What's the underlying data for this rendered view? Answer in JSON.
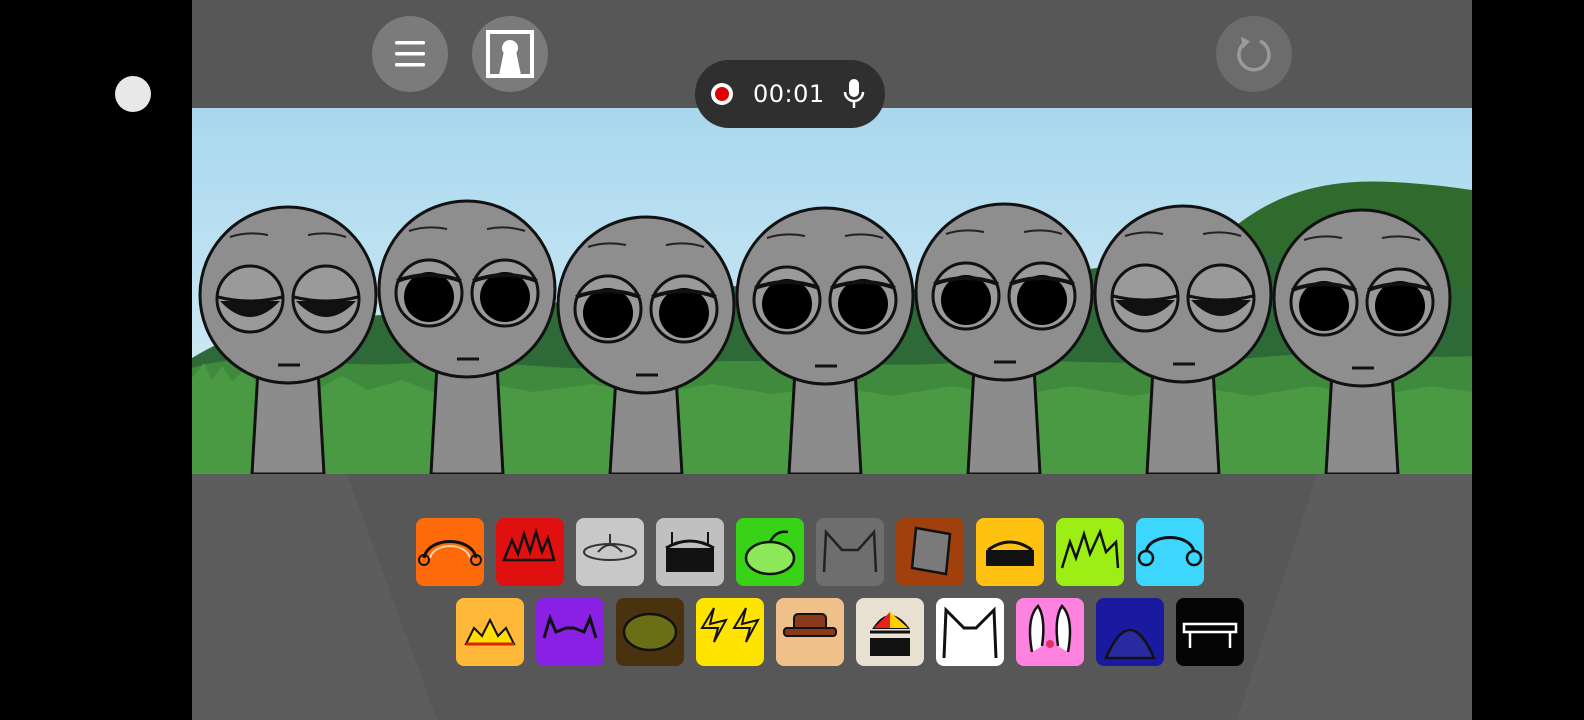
{
  "recorder": {
    "time": "00:01"
  },
  "colors": {
    "background": "#575757",
    "sky": "#a9d9ee",
    "grass": "#4a9a44",
    "record_dot": "#e00000"
  },
  "characters_count": 7,
  "tray": {
    "row1": [
      {
        "name": "orange-antenna-sound",
        "color": "#ff6a0a"
      },
      {
        "name": "red-spiky-sound",
        "color": "#e01010"
      },
      {
        "name": "silver-ufo-sound",
        "color": "#c8c8c8"
      },
      {
        "name": "gray-robot-sound",
        "color": "#c0c0c0"
      },
      {
        "name": "green-pumpkin-sound",
        "color": "#38d316"
      },
      {
        "name": "gray-cat-ears-sound",
        "color": "#6e6e6e"
      },
      {
        "name": "brown-bucket-sound",
        "color": "#a0400c"
      },
      {
        "name": "yellow-helmet-sound",
        "color": "#ffc210"
      },
      {
        "name": "lime-grass-sound",
        "color": "#9cee14"
      },
      {
        "name": "cyan-headphones-sound",
        "color": "#3cd6ff"
      }
    ],
    "row2": [
      {
        "name": "sun-burst-sound",
        "color": "#ffb838"
      },
      {
        "name": "purple-horns-sound",
        "color": "#8a20e4"
      },
      {
        "name": "olive-nest-sound",
        "color": "#4a3210"
      },
      {
        "name": "yellow-lightning-sound",
        "color": "#ffe400"
      },
      {
        "name": "tan-hat-sound",
        "color": "#f0c08a"
      },
      {
        "name": "propeller-cap-sound",
        "color": "#e8e0d0"
      },
      {
        "name": "white-cat-sound",
        "color": "#ffffff"
      },
      {
        "name": "pink-bunny-sound",
        "color": "#ff82e0"
      },
      {
        "name": "navy-dome-sound",
        "color": "#1a1aa0"
      },
      {
        "name": "black-bench-sound",
        "color": "#050505"
      }
    ]
  },
  "icons": [
    "menu-icon",
    "portrait-icon",
    "reset-icon",
    "record-icon",
    "microphone-icon"
  ]
}
